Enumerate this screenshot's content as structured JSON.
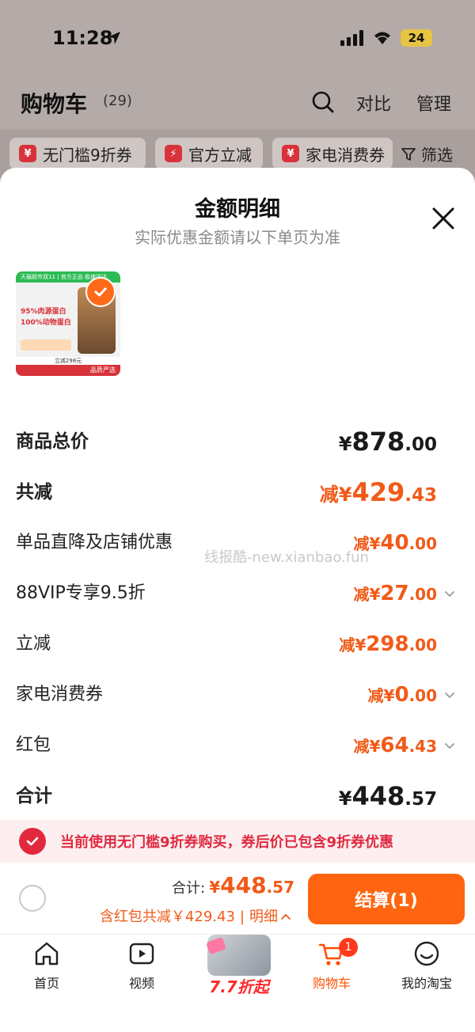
{
  "status_bar": {
    "time": "11:28",
    "battery": "24"
  },
  "background_page": {
    "title": "购物车",
    "count": "(29)",
    "compare_label": "对比",
    "manage_label": "管理",
    "filter_chips": [
      {
        "icon_text": "¥",
        "label": "无门槛9折券"
      },
      {
        "icon_text": "⚡",
        "label": "官方立减"
      },
      {
        "icon_text": "¥",
        "label": "家电消费券"
      }
    ],
    "filter_label": "筛选"
  },
  "sheet": {
    "title": "金额明细",
    "subtitle": "实际优惠金额请以下单页为准",
    "product_thumb": {
      "banner": "天猫超市双11 | 官方正品 极速送达",
      "lines": [
        "95%肉源蛋白",
        "100%动物蛋白"
      ],
      "badge": "品质严选",
      "footer": "立减298元"
    }
  },
  "breakdown": [
    {
      "label": "商品总价",
      "prefix": "",
      "currency": "¥",
      "int": "878",
      "dec": ".00",
      "style": "total",
      "chevron": false
    },
    {
      "label": "共减",
      "prefix": "减",
      "currency": "¥",
      "int": "429",
      "dec": ".43",
      "style": "total-discount",
      "chevron": false
    },
    {
      "label": "单品直降及店铺优惠",
      "prefix": "减",
      "currency": "¥",
      "int": "40",
      "dec": ".00",
      "style": "discount",
      "chevron": false
    },
    {
      "label": "88VIP专享9.5折",
      "prefix": "减",
      "currency": "¥",
      "int": "27",
      "dec": ".00",
      "style": "discount",
      "chevron": true
    },
    {
      "label": "立减",
      "prefix": "减",
      "currency": "¥",
      "int": "298",
      "dec": ".00",
      "style": "discount",
      "chevron": false
    },
    {
      "label": "家电消费券",
      "prefix": "减",
      "currency": "¥",
      "int": "0",
      "dec": ".00",
      "style": "discount",
      "chevron": true
    },
    {
      "label": "红包",
      "prefix": "减",
      "currency": "¥",
      "int": "64",
      "dec": ".43",
      "style": "discount",
      "chevron": true
    },
    {
      "label": "合计",
      "prefix": "",
      "currency": "¥",
      "int": "448",
      "dec": ".57",
      "style": "total",
      "chevron": false
    }
  ],
  "watermark": "线报酷-new.xianbao.fun",
  "coupon_banner": {
    "text": "当前使用无门槛9折券购买，券后价已包含9折券优惠"
  },
  "checkout": {
    "total_label": "合计:",
    "total_currency": "¥",
    "total_int": "448",
    "total_dec": ".57",
    "discount_text": "含红包共减￥429.43",
    "detail_label": "明细",
    "button_label": "结算(1)"
  },
  "tabbar": {
    "items": [
      {
        "label": "首页",
        "icon": "home-icon"
      },
      {
        "label": "视频",
        "icon": "video-icon"
      },
      {
        "label": "购物车",
        "icon": "cart-icon",
        "badge": "1"
      },
      {
        "label": "我的淘宝",
        "icon": "profile-icon"
      }
    ],
    "promo_label": "7.7折起"
  },
  "colors": {
    "accent": "#ff5000",
    "discount": "#f15a18",
    "coupon": "#e02a40"
  }
}
